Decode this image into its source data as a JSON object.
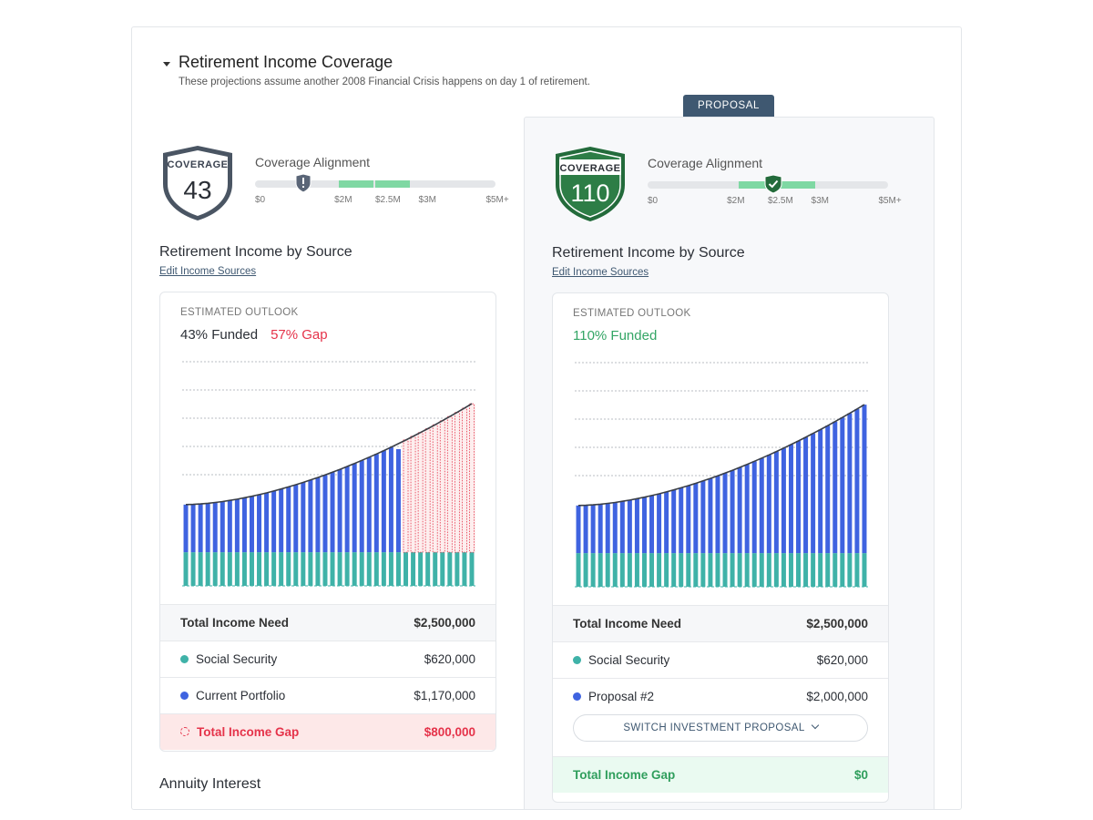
{
  "header": {
    "title": "Retirement Income Coverage",
    "subtitle": "These projections assume another 2008 Financial Crisis happens on day 1 of retirement."
  },
  "proposal_tab": "PROPOSAL",
  "colors": {
    "teal": "#3fb2a8",
    "blue": "#3f63e0",
    "gap_red": "#e5334a",
    "good_green": "#33a565",
    "badge_gray": "#4a5563",
    "badge_green": "#236b3b",
    "align_green": "#7fd8a3"
  },
  "current": {
    "badge_label": "COVERAGE",
    "badge_score": "43",
    "alignment_title": "Coverage Alignment",
    "alignment_marker_value": 1.0,
    "alignment_range": [
      0,
      5.0
    ],
    "ticks": [
      "$0",
      "$2M",
      "$2.5M",
      "$3M",
      "$5M+"
    ],
    "section_title": "Retirement Income by Source",
    "edit_link": "Edit Income Sources",
    "outlook_label": "ESTIMATED OUTLOOK",
    "funded_text": "43% Funded",
    "gap_text": "57% Gap",
    "rows": {
      "need_label": "Total Income Need",
      "need_value": "$2,500,000",
      "ss_label": "Social Security",
      "ss_value": "$620,000",
      "portfolio_label": "Current Portfolio",
      "portfolio_value": "$1,170,000",
      "gap_label": "Total Income Gap",
      "gap_value": "$800,000"
    },
    "next_section": "Annuity Interest"
  },
  "proposal": {
    "badge_label": "COVERAGE",
    "badge_score": "110",
    "alignment_title": "Coverage Alignment",
    "alignment_marker_value": 2.6,
    "alignment_range": [
      0,
      5.0
    ],
    "ticks": [
      "$0",
      "$2M",
      "$2.5M",
      "$3M",
      "$5M+"
    ],
    "section_title": "Retirement Income by Source",
    "edit_link": "Edit Income Sources",
    "outlook_label": "ESTIMATED OUTLOOK",
    "funded_text": "110% Funded",
    "rows": {
      "need_label": "Total Income Need",
      "need_value": "$2,500,000",
      "ss_label": "Social Security",
      "ss_value": "$620,000",
      "portfolio_label": "Proposal #2",
      "portfolio_value": "$2,000,000",
      "switch_label": "SWITCH INVESTMENT PROPOSAL",
      "gap_label": "Total Income Gap",
      "gap_value": "$0"
    }
  },
  "chart_data": [
    {
      "type": "bar",
      "bars": 40,
      "social_security": 12,
      "need_start": 29,
      "need_end": 65,
      "funded_bars": 30,
      "ylim": [
        0,
        80
      ],
      "grid": true
    },
    {
      "type": "bar",
      "bars": 40,
      "social_security": 12,
      "need_start": 29,
      "need_end": 65,
      "funded_bars": 40,
      "ylim": [
        0,
        80
      ],
      "grid": true
    }
  ]
}
